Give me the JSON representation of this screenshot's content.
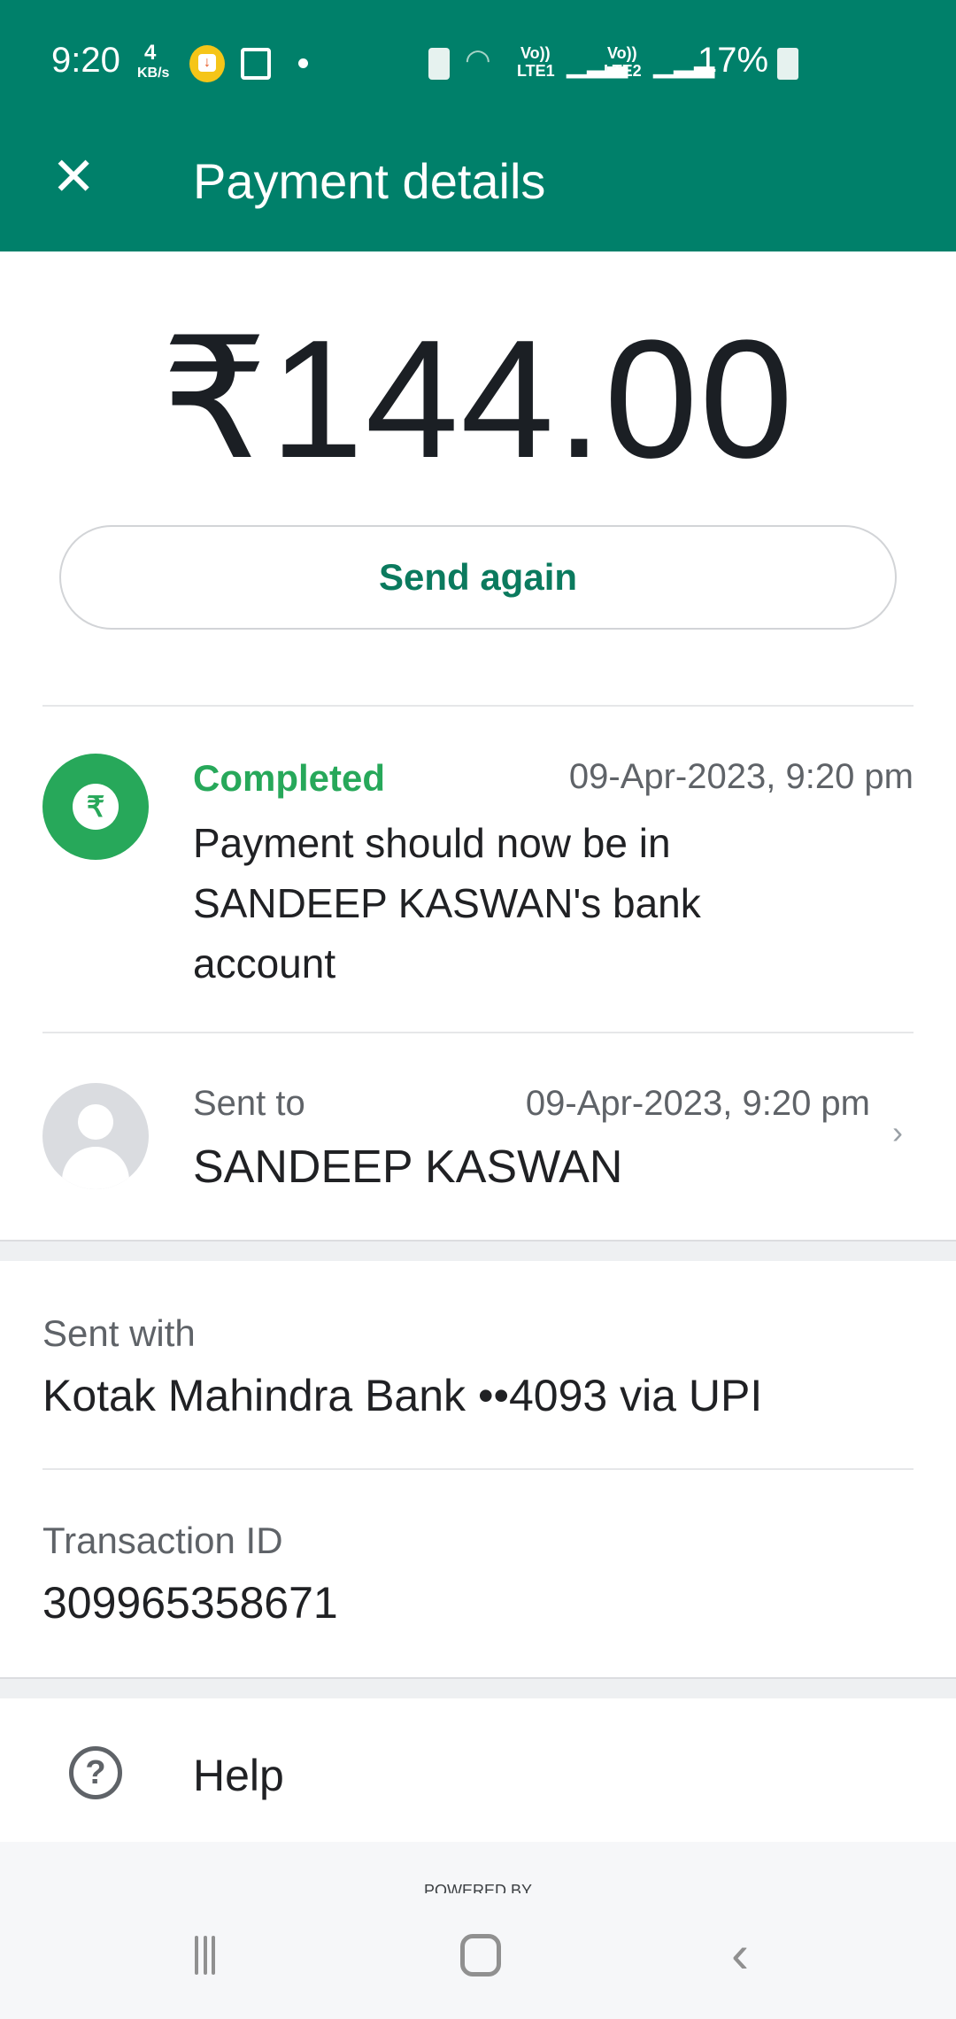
{
  "status_bar": {
    "time": "9:20",
    "net_speed_value": "4",
    "net_speed_unit": "KB/s",
    "sim1": "LTE1",
    "sim2": "LTE2",
    "volte": "Vo))",
    "battery": "17%"
  },
  "header": {
    "title": "Payment details",
    "close_icon": "close-icon"
  },
  "amount": "₹144.00",
  "send_again": "Send again",
  "status": {
    "label": "Completed",
    "date": "09-Apr-2023, 9:20 pm",
    "lines": [
      "Payment should now be in",
      "SANDEEP  KASWAN's bank",
      "account"
    ],
    "icon": "rupee-icon",
    "color": "#27a85a"
  },
  "recipient": {
    "label": "Sent to",
    "date": "09-Apr-2023, 9:20 pm",
    "name": "SANDEEP  KASWAN"
  },
  "sent_with": {
    "label": "Sent with",
    "value": "Kotak Mahindra Bank ••4093 via UPI"
  },
  "transaction": {
    "label": "Transaction ID",
    "value": "309965358671"
  },
  "help": {
    "label": "Help"
  },
  "footer": {
    "powered_by": "POWERED BY"
  },
  "colors": {
    "brand": "#00806a",
    "accent": "#0b7a5e"
  }
}
